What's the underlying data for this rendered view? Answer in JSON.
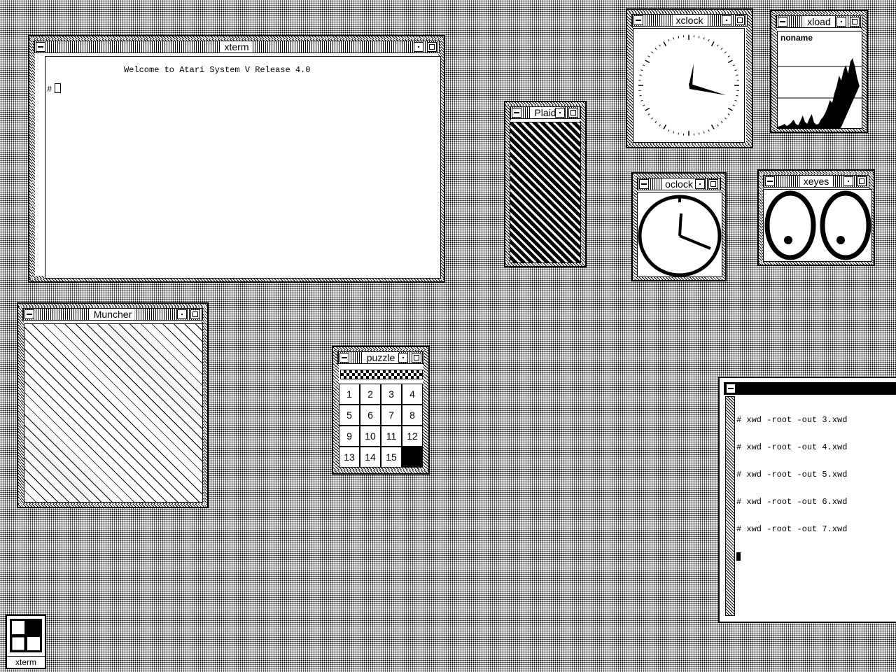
{
  "windows": {
    "xterm_main": {
      "title": "xterm",
      "welcome": "Welcome to Atari System V Release 4.0",
      "prompt": "#"
    },
    "muncher": {
      "title": "Muncher"
    },
    "puzzle": {
      "title": "puzzle",
      "tiles": [
        "1",
        "2",
        "3",
        "4",
        "5",
        "6",
        "7",
        "8",
        "9",
        "10",
        "11",
        "12",
        "13",
        "14",
        "15",
        ""
      ]
    },
    "plaid": {
      "title": "Plaid"
    },
    "xclock": {
      "title": "xclock"
    },
    "xload": {
      "title": "xload",
      "host": "noname"
    },
    "oclock": {
      "title": "oclock"
    },
    "xeyes": {
      "title": "xeyes"
    },
    "xterm_right": {
      "title": "",
      "lines": [
        "# xwd -root -out 3.xwd",
        "# xwd -root -out 4.xwd",
        "# xwd -root -out 5.xwd",
        "# xwd -root -out 6.xwd",
        "# xwd -root -out 7.xwd"
      ]
    }
  },
  "icon": {
    "label": "xterm"
  }
}
